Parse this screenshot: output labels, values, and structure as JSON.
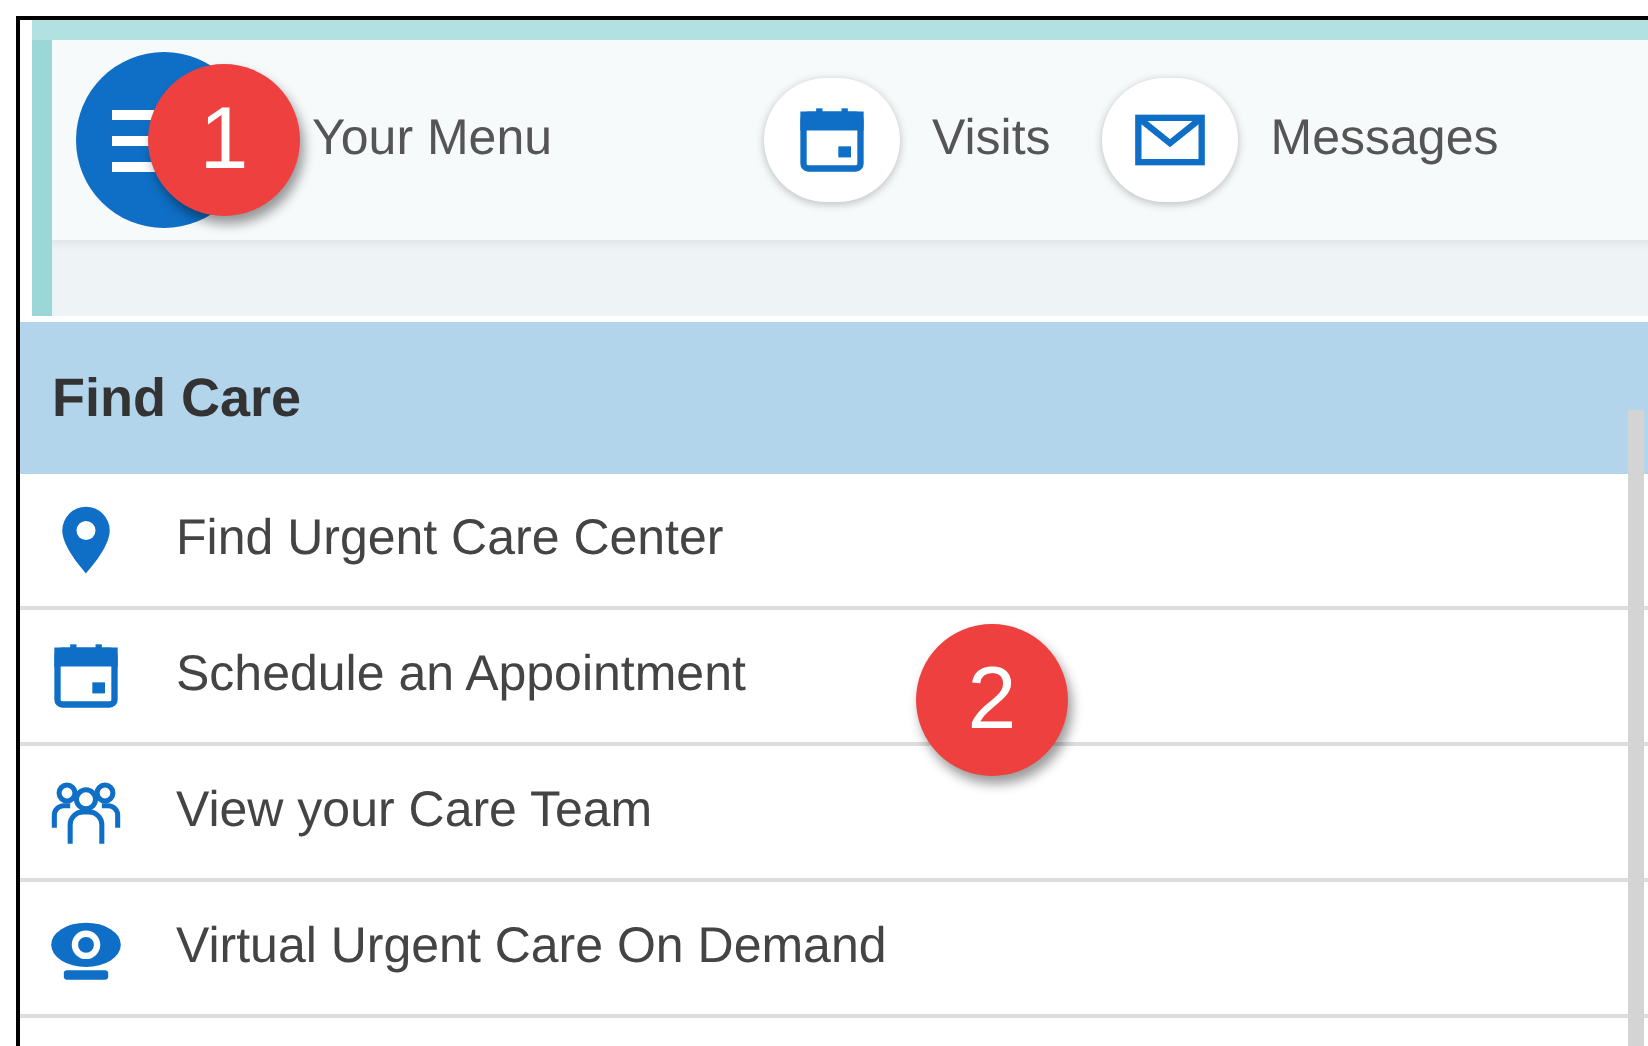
{
  "nav": {
    "menu_label": "Your Menu",
    "items": [
      {
        "kind": "calendar",
        "label": "Visits"
      },
      {
        "kind": "mail",
        "label": "Messages"
      }
    ]
  },
  "callouts": [
    {
      "label": "1"
    },
    {
      "label": "2"
    }
  ],
  "section": {
    "title": "Find Care",
    "items": [
      {
        "kind": "pin",
        "label": "Find Urgent Care Center"
      },
      {
        "kind": "calendar",
        "label": "Schedule an Appointment"
      },
      {
        "kind": "team",
        "label": "View your Care Team"
      },
      {
        "kind": "camera",
        "label": "Virtual Urgent Care On Demand"
      }
    ]
  }
}
